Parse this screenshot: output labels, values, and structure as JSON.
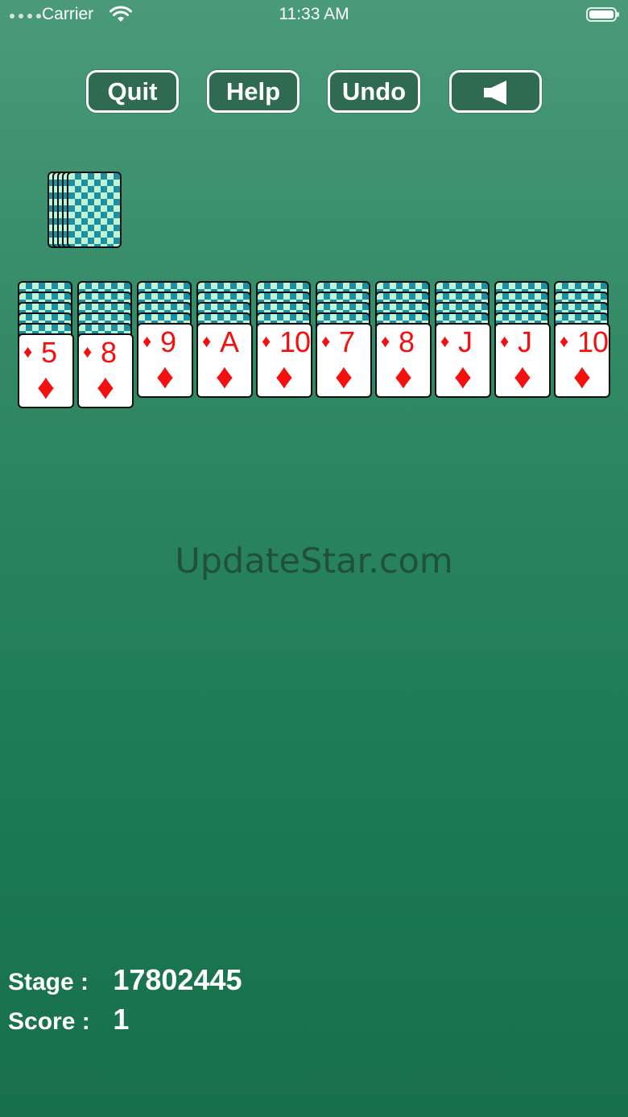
{
  "status_bar": {
    "carrier": "Carrier",
    "time": "11:33 AM"
  },
  "toolbar": {
    "quit": "Quit",
    "help": "Help",
    "undo": "Undo",
    "sound_icon": "speaker-icon"
  },
  "tableau": [
    {
      "rank": "5",
      "suit": "♦",
      "hidden": 5
    },
    {
      "rank": "8",
      "suit": "♦",
      "hidden": 5
    },
    {
      "rank": "9",
      "suit": "♦",
      "hidden": 4
    },
    {
      "rank": "A",
      "suit": "♦",
      "hidden": 4
    },
    {
      "rank": "10",
      "suit": "♦",
      "hidden": 4
    },
    {
      "rank": "7",
      "suit": "♦",
      "hidden": 4
    },
    {
      "rank": "8",
      "suit": "♦",
      "hidden": 4
    },
    {
      "rank": "J",
      "suit": "♦",
      "hidden": 4
    },
    {
      "rank": "J",
      "suit": "♦",
      "hidden": 4
    },
    {
      "rank": "10",
      "suit": "♦",
      "hidden": 4
    }
  ],
  "stock_piles": 5,
  "watermark": "UpdateStar.com",
  "stats": {
    "stage_label": "Stage :",
    "stage_value": "17802445",
    "score_label": "Score :",
    "score_value": "1"
  },
  "colors": {
    "suit_red": "#f51010",
    "card_back_teal": "#1c8fa0",
    "card_back_mint": "#bff5d6",
    "button_fill": "#2e6b51"
  }
}
